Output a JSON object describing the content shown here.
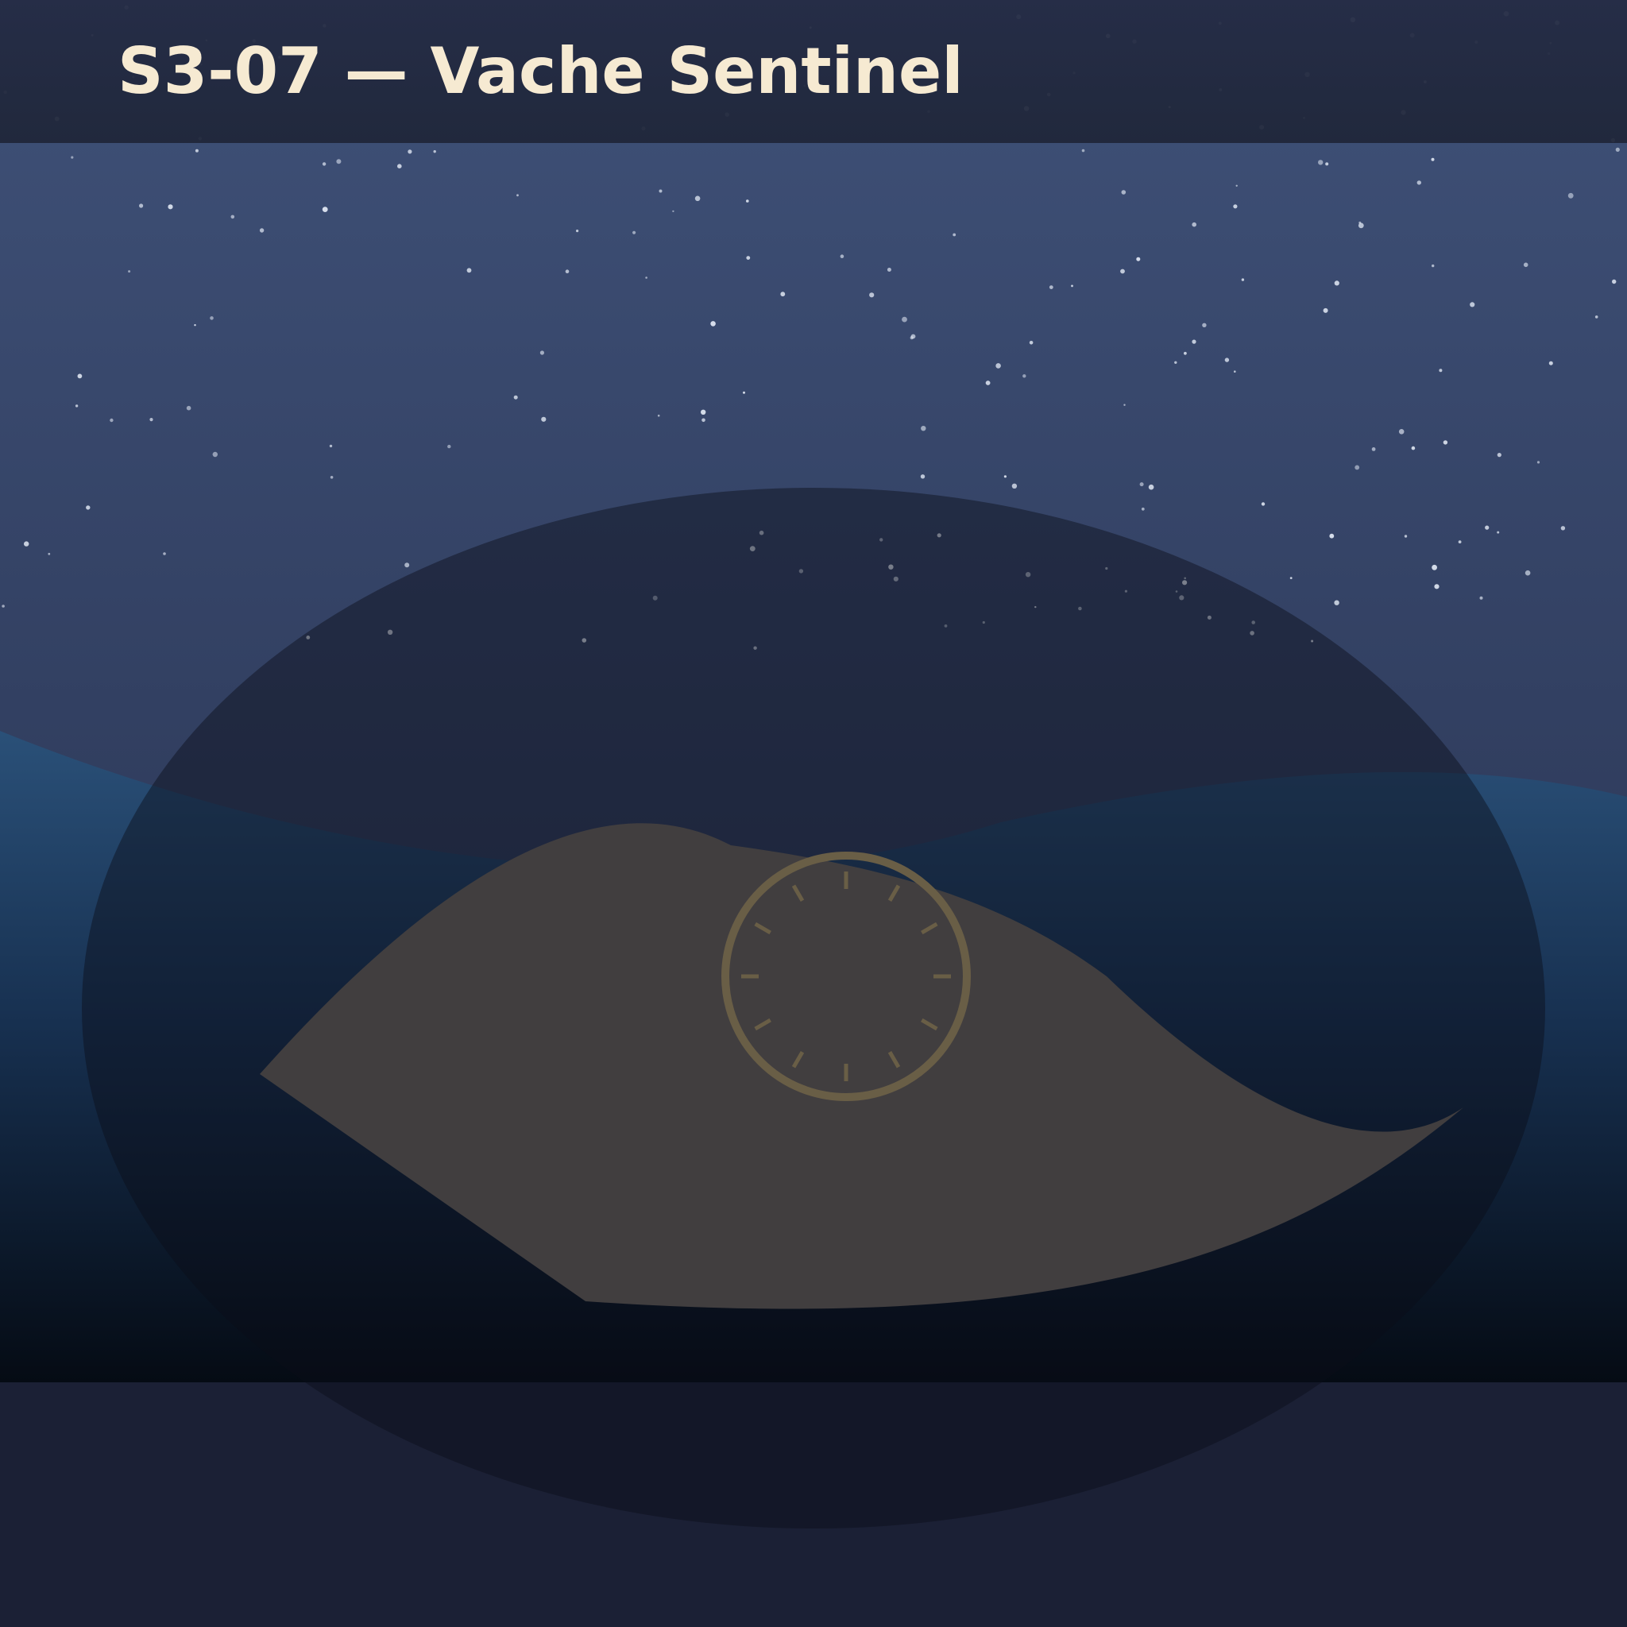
{
  "level": {
    "title": "S3-07 — Vache Sentinel"
  },
  "palette": {
    "title_text": "#f6ead2",
    "header_band": "#232a40",
    "sky_top": "#3f5178",
    "sky_bottom": "#26304d",
    "sea_top": "#2a4e78",
    "sea_bottom": "#050b14",
    "footer": "#1b2035",
    "vignette": "#0b0e18",
    "island": "#6e6660",
    "clock_ring": "#b7a06c",
    "star": "#dfe6f2"
  },
  "icons": {
    "island": "island-silhouette",
    "clock": "clock-dial-icon"
  }
}
